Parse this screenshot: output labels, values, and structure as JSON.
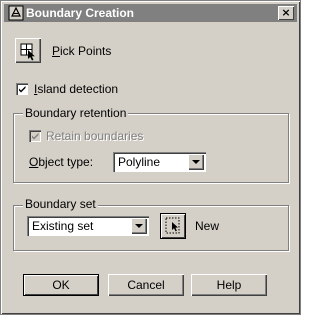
{
  "window": {
    "title": "Boundary Creation",
    "close_glyph": "×"
  },
  "pick_points": {
    "icon": "pick-points-icon",
    "label_mnemonic": "P",
    "label_rest": "ick Points"
  },
  "island_detection": {
    "checked": true,
    "label_mnemonic": "I",
    "label_rest": "sland detection"
  },
  "boundary_retention": {
    "legend": "Boundary retention",
    "retain": {
      "checked": true,
      "enabled": false,
      "label": "Retain boundaries"
    },
    "object_type": {
      "label_mnemonic": "O",
      "label_rest": "bject type:",
      "value": "Polyline"
    }
  },
  "boundary_set": {
    "legend": "Boundary set",
    "value": "Existing set",
    "select_icon": "select-objects-icon",
    "new_label": "New"
  },
  "buttons": {
    "ok": "OK",
    "cancel": "Cancel",
    "help": "Help"
  }
}
